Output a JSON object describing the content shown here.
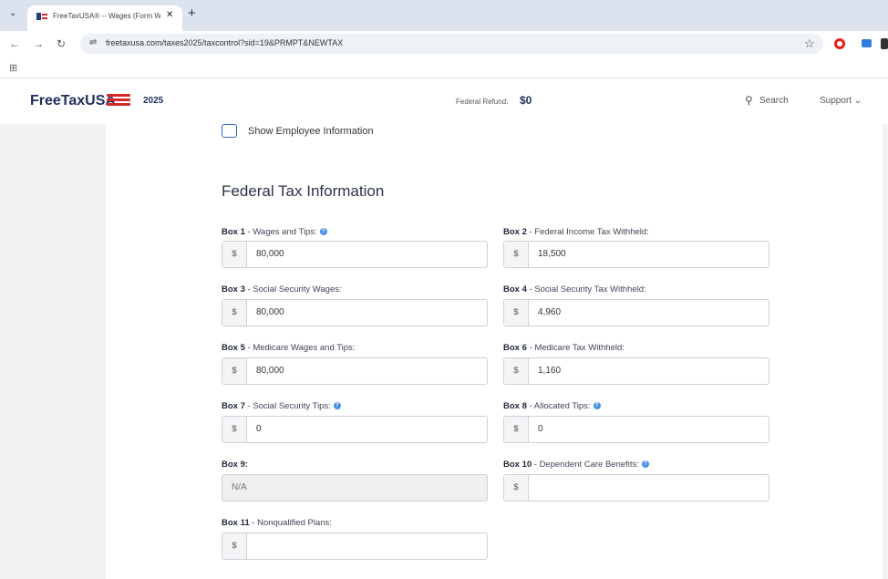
{
  "browser": {
    "tab_title": "FreeTaxUSA® -- Wages (Form W-2)",
    "url": "freetaxusa.com/taxes2025/taxcontrol?sid=19&PRMPT&NEWTAX"
  },
  "header": {
    "logo": "FreeTaxUSA",
    "year": "2025",
    "refund_label": "Federal Refund:",
    "refund_value": "$0",
    "search_label": "Search",
    "support_label": "Support"
  },
  "checkbox_label": "Show Employee Information",
  "section_title": "Federal Tax Information",
  "currency_symbol": "$",
  "fields": [
    {
      "box": "Box 1",
      "desc": " - Wages and Tips:",
      "value": "80,000"
    },
    {
      "box": "Box 2",
      "desc": " - Federal Income Tax Withheld:",
      "value": "18,500"
    },
    {
      "box": "Box 3",
      "desc": " - Social Security Wages:",
      "value": "80,000"
    },
    {
      "box": "Box 4",
      "desc": " - Social Security Tax Withheld:",
      "value": "4,960"
    },
    {
      "box": "Box 5",
      "desc": " - Medicare Wages and Tips:",
      "value": "80,000"
    },
    {
      "box": "Box 6",
      "desc": " - Medicare Tax Withheld:",
      "value": "1,160"
    },
    {
      "box": "Box 7",
      "desc": " - Social Security Tips:",
      "value": "0"
    },
    {
      "box": "Box 8",
      "desc": " - Allocated Tips:",
      "value": "0"
    },
    {
      "box": "Box 9:",
      "desc": "",
      "value": "N/A"
    },
    {
      "box": "Box 10",
      "desc": " - Dependent Care Benefits:",
      "value": ""
    },
    {
      "box": "Box 11",
      "desc": " - Nonqualified Plans:",
      "value": ""
    }
  ]
}
